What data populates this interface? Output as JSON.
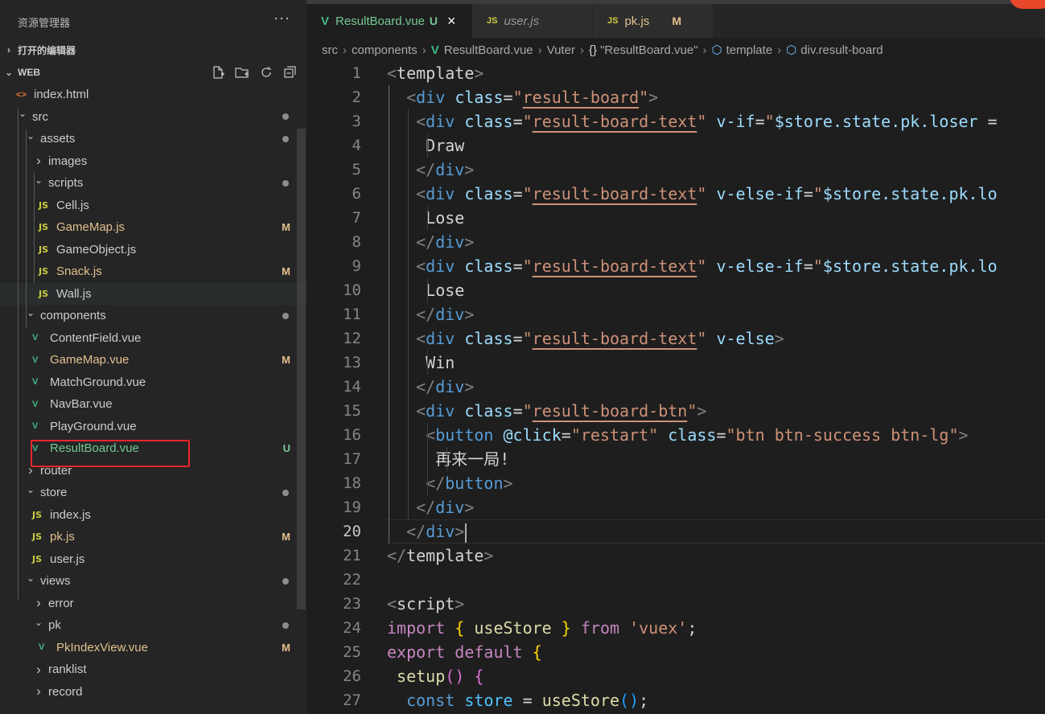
{
  "sidebar": {
    "title": "资源管理器",
    "more": "···",
    "open_editors": "打开的编辑器",
    "workspace": "WEB",
    "tree": [
      {
        "label": "index.html",
        "depth": 1,
        "kind": "html-file"
      },
      {
        "label": "src",
        "depth": 1,
        "kind": "folder-open",
        "dot": true
      },
      {
        "label": "assets",
        "depth": 2,
        "kind": "folder-open",
        "dot": true
      },
      {
        "label": "images",
        "depth": 3,
        "kind": "folder-closed"
      },
      {
        "label": "scripts",
        "depth": 3,
        "kind": "folder-open",
        "dot": true
      },
      {
        "label": "Cell.js",
        "depth": 4,
        "kind": "js-file"
      },
      {
        "label": "GameMap.js",
        "depth": 4,
        "kind": "js-file",
        "status": "M"
      },
      {
        "label": "GameObject.js",
        "depth": 4,
        "kind": "js-file"
      },
      {
        "label": "Snack.js",
        "depth": 4,
        "kind": "js-file",
        "status": "M"
      },
      {
        "label": "Wall.js",
        "depth": 4,
        "kind": "js-file",
        "hovered": true
      },
      {
        "label": "components",
        "depth": 2,
        "kind": "folder-open",
        "dot": true
      },
      {
        "label": "ContentField.vue",
        "depth": 3,
        "kind": "vue-file"
      },
      {
        "label": "GameMap.vue",
        "depth": 3,
        "kind": "vue-file",
        "status": "M"
      },
      {
        "label": "MatchGround.vue",
        "depth": 3,
        "kind": "vue-file"
      },
      {
        "label": "NavBar.vue",
        "depth": 3,
        "kind": "vue-file"
      },
      {
        "label": "PlayGround.vue",
        "depth": 3,
        "kind": "vue-file"
      },
      {
        "label": "ResultBoard.vue",
        "depth": 3,
        "kind": "vue-file",
        "status": "U"
      },
      {
        "label": "router",
        "depth": 2,
        "kind": "folder-closed"
      },
      {
        "label": "store",
        "depth": 2,
        "kind": "folder-open",
        "dot": true
      },
      {
        "label": "index.js",
        "depth": 3,
        "kind": "js-file"
      },
      {
        "label": "pk.js",
        "depth": 3,
        "kind": "js-file",
        "status": "M"
      },
      {
        "label": "user.js",
        "depth": 3,
        "kind": "js-file"
      },
      {
        "label": "views",
        "depth": 2,
        "kind": "folder-open",
        "dot": true
      },
      {
        "label": "error",
        "depth": 3,
        "kind": "folder-closed"
      },
      {
        "label": "pk",
        "depth": 3,
        "kind": "folder-open",
        "dot": true
      },
      {
        "label": "PkIndexView.vue",
        "depth": 4,
        "kind": "vue-file",
        "status": "M"
      },
      {
        "label": "ranklist",
        "depth": 3,
        "kind": "folder-closed"
      },
      {
        "label": "record",
        "depth": 3,
        "kind": "folder-closed"
      }
    ]
  },
  "tabs": [
    {
      "icon": "V",
      "name": "ResultBoard.vue",
      "status": "U",
      "active": true,
      "close": "×"
    },
    {
      "icon": "JS",
      "name": "user.js",
      "status": "",
      "italic": true
    },
    {
      "icon": "JS",
      "name": "pk.js",
      "status": "M",
      "modified": true
    }
  ],
  "breadcrumb": {
    "parts": [
      "src",
      "components",
      "ResultBoard.vue",
      "Vuter",
      "\"ResultBoard.vue\"",
      "template",
      "div.result-board"
    ],
    "braces": "{}"
  },
  "code": {
    "current_line": 20,
    "lines": [
      {
        "n": "1",
        "tokens": [
          [
            "t-br",
            "<"
          ],
          [
            "t-plain",
            "template"
          ],
          [
            "t-br",
            ">"
          ]
        ]
      },
      {
        "n": "2",
        "tokens": [
          [
            "t-plain",
            "  "
          ],
          [
            "t-br",
            "<"
          ],
          [
            "t-tag",
            "div"
          ],
          [
            "t-plain",
            " "
          ],
          [
            "t-attr",
            "class"
          ],
          [
            "t-plain",
            "="
          ],
          [
            "t-str",
            "\""
          ],
          [
            "t-str-u",
            "result-board"
          ],
          [
            "t-str",
            "\""
          ],
          [
            "t-br",
            ">"
          ]
        ]
      },
      {
        "n": "3",
        "tokens": [
          [
            "t-plain",
            "   "
          ],
          [
            "t-br",
            "<"
          ],
          [
            "t-tag",
            "div"
          ],
          [
            "t-plain",
            " "
          ],
          [
            "t-attr",
            "class"
          ],
          [
            "t-plain",
            "="
          ],
          [
            "t-str",
            "\""
          ],
          [
            "t-str-u",
            "result-board-text"
          ],
          [
            "t-str",
            "\""
          ],
          [
            "t-plain",
            " "
          ],
          [
            "t-attr",
            "v-if"
          ],
          [
            "t-plain",
            "="
          ],
          [
            "t-str",
            "\""
          ],
          [
            "t-attr",
            "$store.state.pk.loser"
          ],
          [
            "t-plain",
            " ="
          ]
        ]
      },
      {
        "n": "4",
        "tokens": [
          [
            "t-plain",
            "    Draw"
          ]
        ]
      },
      {
        "n": "5",
        "tokens": [
          [
            "t-plain",
            "   "
          ],
          [
            "t-br",
            "</"
          ],
          [
            "t-tag",
            "div"
          ],
          [
            "t-br",
            ">"
          ]
        ]
      },
      {
        "n": "6",
        "tokens": [
          [
            "t-plain",
            "   "
          ],
          [
            "t-br",
            "<"
          ],
          [
            "t-tag",
            "div"
          ],
          [
            "t-plain",
            " "
          ],
          [
            "t-attr",
            "class"
          ],
          [
            "t-plain",
            "="
          ],
          [
            "t-str",
            "\""
          ],
          [
            "t-str-u",
            "result-board-text"
          ],
          [
            "t-str",
            "\""
          ],
          [
            "t-plain",
            " "
          ],
          [
            "t-attr",
            "v-else-if"
          ],
          [
            "t-plain",
            "="
          ],
          [
            "t-str",
            "\""
          ],
          [
            "t-attr",
            "$store.state.pk.lo"
          ]
        ]
      },
      {
        "n": "7",
        "tokens": [
          [
            "t-plain",
            "    Lose"
          ]
        ]
      },
      {
        "n": "8",
        "tokens": [
          [
            "t-plain",
            "   "
          ],
          [
            "t-br",
            "</"
          ],
          [
            "t-tag",
            "div"
          ],
          [
            "t-br",
            ">"
          ]
        ]
      },
      {
        "n": "9",
        "tokens": [
          [
            "t-plain",
            "   "
          ],
          [
            "t-br",
            "<"
          ],
          [
            "t-tag",
            "div"
          ],
          [
            "t-plain",
            " "
          ],
          [
            "t-attr",
            "class"
          ],
          [
            "t-plain",
            "="
          ],
          [
            "t-str",
            "\""
          ],
          [
            "t-str-u",
            "result-board-text"
          ],
          [
            "t-str",
            "\""
          ],
          [
            "t-plain",
            " "
          ],
          [
            "t-attr",
            "v-else-if"
          ],
          [
            "t-plain",
            "="
          ],
          [
            "t-str",
            "\""
          ],
          [
            "t-attr",
            "$store.state.pk.lo"
          ]
        ]
      },
      {
        "n": "10",
        "tokens": [
          [
            "t-plain",
            "    Lose"
          ]
        ]
      },
      {
        "n": "11",
        "tokens": [
          [
            "t-plain",
            "   "
          ],
          [
            "t-br",
            "</"
          ],
          [
            "t-tag",
            "div"
          ],
          [
            "t-br",
            ">"
          ]
        ]
      },
      {
        "n": "12",
        "tokens": [
          [
            "t-plain",
            "   "
          ],
          [
            "t-br",
            "<"
          ],
          [
            "t-tag",
            "div"
          ],
          [
            "t-plain",
            " "
          ],
          [
            "t-attr",
            "class"
          ],
          [
            "t-plain",
            "="
          ],
          [
            "t-str",
            "\""
          ],
          [
            "t-str-u",
            "result-board-text"
          ],
          [
            "t-str",
            "\""
          ],
          [
            "t-plain",
            " "
          ],
          [
            "t-attr",
            "v-else"
          ],
          [
            "t-br",
            ">"
          ]
        ]
      },
      {
        "n": "13",
        "tokens": [
          [
            "t-plain",
            "    Win"
          ]
        ]
      },
      {
        "n": "14",
        "tokens": [
          [
            "t-plain",
            "   "
          ],
          [
            "t-br",
            "</"
          ],
          [
            "t-tag",
            "div"
          ],
          [
            "t-br",
            ">"
          ]
        ]
      },
      {
        "n": "15",
        "tokens": [
          [
            "t-plain",
            "   "
          ],
          [
            "t-br",
            "<"
          ],
          [
            "t-tag",
            "div"
          ],
          [
            "t-plain",
            " "
          ],
          [
            "t-attr",
            "class"
          ],
          [
            "t-plain",
            "="
          ],
          [
            "t-str",
            "\""
          ],
          [
            "t-str-u",
            "result-board-btn"
          ],
          [
            "t-str",
            "\""
          ],
          [
            "t-br",
            ">"
          ]
        ]
      },
      {
        "n": "16",
        "tokens": [
          [
            "t-plain",
            "    "
          ],
          [
            "t-br",
            "<"
          ],
          [
            "t-tag",
            "button"
          ],
          [
            "t-plain",
            " "
          ],
          [
            "t-attr",
            "@click"
          ],
          [
            "t-plain",
            "="
          ],
          [
            "t-str",
            "\"restart\""
          ],
          [
            "t-plain",
            " "
          ],
          [
            "t-attr",
            "class"
          ],
          [
            "t-plain",
            "="
          ],
          [
            "t-str",
            "\"btn btn-success btn-lg\""
          ],
          [
            "t-br",
            ">"
          ]
        ]
      },
      {
        "n": "17",
        "tokens": [
          [
            "t-plain",
            "     再来一局!"
          ]
        ]
      },
      {
        "n": "18",
        "tokens": [
          [
            "t-plain",
            "    "
          ],
          [
            "t-br",
            "</"
          ],
          [
            "t-tag",
            "button"
          ],
          [
            "t-br",
            ">"
          ]
        ]
      },
      {
        "n": "19",
        "tokens": [
          [
            "t-plain",
            "   "
          ],
          [
            "t-br",
            "</"
          ],
          [
            "t-tag",
            "div"
          ],
          [
            "t-br",
            ">"
          ]
        ]
      },
      {
        "n": "20",
        "tokens": [
          [
            "t-plain",
            "  "
          ],
          [
            "t-br",
            "</"
          ],
          [
            "t-tag",
            "div"
          ],
          [
            "t-br",
            ">"
          ]
        ],
        "cursor": true
      },
      {
        "n": "21",
        "tokens": [
          [
            "t-br",
            "</"
          ],
          [
            "t-plain",
            "template"
          ],
          [
            "t-br",
            ">"
          ]
        ]
      },
      {
        "n": "22",
        "tokens": []
      },
      {
        "n": "23",
        "tokens": [
          [
            "t-br",
            "<"
          ],
          [
            "t-plain",
            "script"
          ],
          [
            "t-br",
            ">"
          ]
        ]
      },
      {
        "n": "24",
        "tokens": [
          [
            "t-kw",
            "import"
          ],
          [
            "t-plain",
            " "
          ],
          [
            "t-brace1",
            "{"
          ],
          [
            "t-plain",
            " "
          ],
          [
            "t-fn",
            "useStore"
          ],
          [
            "t-plain",
            " "
          ],
          [
            "t-brace1",
            "}"
          ],
          [
            "t-plain",
            " "
          ],
          [
            "t-kw",
            "from"
          ],
          [
            "t-plain",
            " "
          ],
          [
            "t-str",
            "'vuex'"
          ],
          [
            "t-plain",
            ";"
          ]
        ]
      },
      {
        "n": "25",
        "tokens": [
          [
            "t-kw",
            "export"
          ],
          [
            "t-plain",
            " "
          ],
          [
            "t-kw",
            "default"
          ],
          [
            "t-plain",
            " "
          ],
          [
            "t-brace1",
            "{"
          ]
        ]
      },
      {
        "n": "26",
        "tokens": [
          [
            "t-plain",
            " "
          ],
          [
            "t-fn",
            "setup"
          ],
          [
            "t-brace2",
            "()"
          ],
          [
            "t-plain",
            " "
          ],
          [
            "t-brace2",
            "{"
          ]
        ]
      },
      {
        "n": "27",
        "tokens": [
          [
            "t-plain",
            "  "
          ],
          [
            "t-kwb",
            "const"
          ],
          [
            "t-plain",
            " "
          ],
          [
            "t-var",
            "store"
          ],
          [
            "t-plain",
            " = "
          ],
          [
            "t-fn",
            "useStore"
          ],
          [
            "t-brace3",
            "()"
          ],
          [
            "t-plain",
            ";"
          ]
        ]
      }
    ]
  }
}
